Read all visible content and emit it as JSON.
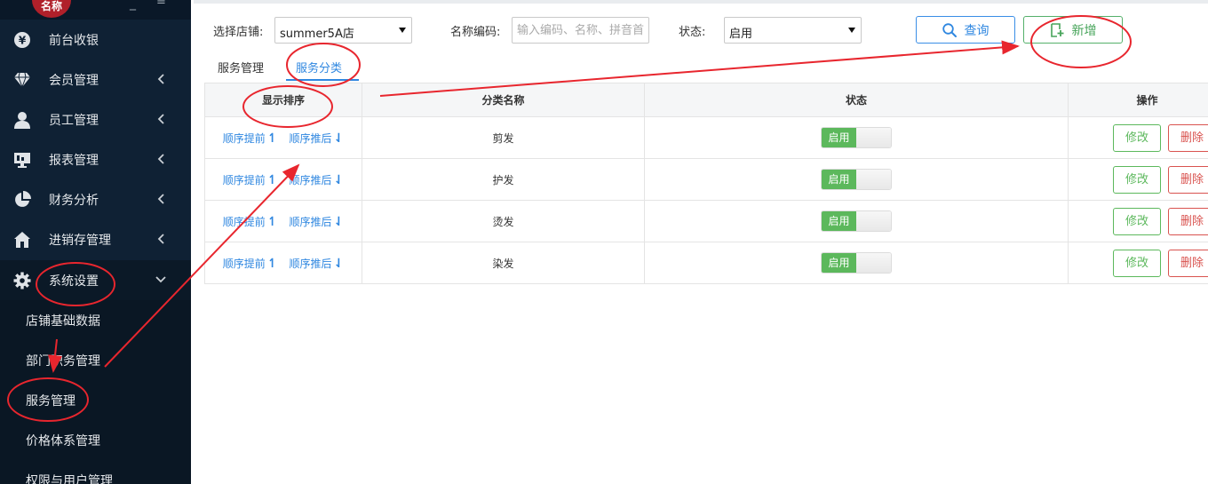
{
  "brand": {
    "logo_text": "名称",
    "minimize": "_",
    "menu_glyph": "≡"
  },
  "sidebar": {
    "items": [
      {
        "label": "前台收银",
        "icon": "yen-icon"
      },
      {
        "label": "会员管理",
        "icon": "diamond-icon"
      },
      {
        "label": "员工管理",
        "icon": "user-icon"
      },
      {
        "label": "报表管理",
        "icon": "monitor-icon"
      },
      {
        "label": "财务分析",
        "icon": "pie-chart-icon"
      },
      {
        "label": "进销存管理",
        "icon": "home-icon"
      },
      {
        "label": "系统设置",
        "icon": "gear-icon"
      }
    ],
    "subitems": [
      {
        "label": "店铺基础数据"
      },
      {
        "label": "部门职务管理"
      },
      {
        "label": "服务管理"
      },
      {
        "label": "价格体系管理"
      },
      {
        "label": "权限与用户管理"
      }
    ]
  },
  "filters": {
    "store_label": "选择店铺:",
    "store_value": "summer5A店",
    "code_label": "名称编码:",
    "code_placeholder": "输入编码、名称、拼音首字母",
    "status_label": "状态:",
    "status_value": "启用",
    "query_label": "查询",
    "add_label": "新增"
  },
  "tabs": [
    {
      "label": "服务管理"
    },
    {
      "label": "服务分类"
    }
  ],
  "table": {
    "headers": [
      "显示排序",
      "分类名称",
      "状态",
      "操作"
    ],
    "sort_up_label": "顺序提前",
    "sort_down_label": "顺序推后",
    "toggle_on_label": "启用",
    "edit_label": "修改",
    "delete_label": "删除",
    "rows": [
      {
        "name": "剪发"
      },
      {
        "name": "护发"
      },
      {
        "name": "烫发"
      },
      {
        "name": "染发"
      }
    ]
  },
  "colors": {
    "sidebar_bg": "#0f2134",
    "accent_blue": "#2f87e0",
    "success_green": "#5cb85c",
    "danger_red": "#d9534f",
    "annotation_red": "#e8262e"
  }
}
